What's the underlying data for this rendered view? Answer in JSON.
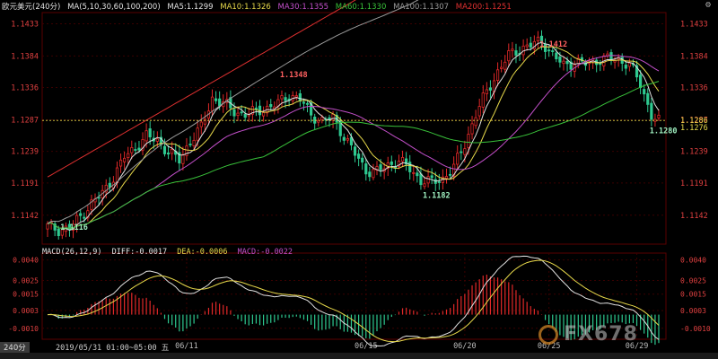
{
  "header": {
    "symbol": "欧元美元(240分)",
    "ma_params": "MA(5,10,30,60,100,200)",
    "ma_values": [
      {
        "label": "MA5:1.1299",
        "color": "#e0e0e0"
      },
      {
        "label": "MA10:1.1326",
        "color": "#e6d84a"
      },
      {
        "label": "MA30:1.1355",
        "color": "#c24fc9"
      },
      {
        "label": "MA60:1.1330",
        "color": "#39c23a"
      },
      {
        "label": "MA100:1.1307",
        "color": "#9a9a9a"
      },
      {
        "label": "MA200:1.1251",
        "color": "#e03030"
      }
    ]
  },
  "macd_header": {
    "params": "MACD(26,12,9)",
    "diff": "DIFF:-0.0017",
    "dea": "DEA:-0.0006",
    "macd": "MACD:-0.0022"
  },
  "footer": {
    "timeframe": "240分",
    "datetime": "2019/05/31 01:00~05:00 五",
    "watermark": "FX678"
  },
  "chart_data": [
    {
      "type": "candlestick",
      "title": "欧元美元(240分)",
      "y_ticks": [
        1.1433,
        1.1384,
        1.1336,
        1.1287,
        1.1239,
        1.1191,
        1.1142
      ],
      "ylim": [
        1.1098,
        1.145
      ],
      "x_ticks": [
        "06/11",
        "06/15",
        "06/20",
        "06/25",
        "06/29"
      ],
      "current_price_labels": [
        "1.1286",
        "1.1276"
      ],
      "annotations": [
        {
          "text": "1.1116",
          "value": 1.1116
        },
        {
          "text": "1.1348",
          "value": 1.1348
        },
        {
          "text": "1.1182",
          "value": 1.1182
        },
        {
          "text": "1.1412",
          "value": 1.1412
        },
        {
          "text": "1.1280",
          "value": 1.128
        }
      ],
      "close_anchors": [
        [
          0,
          1.1125
        ],
        [
          3,
          1.112
        ],
        [
          6,
          1.1122
        ],
        [
          9,
          1.114
        ],
        [
          12,
          1.116
        ],
        [
          15,
          1.1175
        ],
        [
          18,
          1.12
        ],
        [
          21,
          1.123
        ],
        [
          24,
          1.1245
        ],
        [
          27,
          1.1262
        ],
        [
          30,
          1.1255
        ],
        [
          33,
          1.1238
        ],
        [
          36,
          1.1225
        ],
        [
          39,
          1.1255
        ],
        [
          42,
          1.1275
        ],
        [
          45,
          1.132
        ],
        [
          48,
          1.1312
        ],
        [
          51,
          1.13
        ],
        [
          54,
          1.1295
        ],
        [
          57,
          1.13
        ],
        [
          60,
          1.1305
        ],
        [
          63,
          1.1312
        ],
        [
          66,
          1.1325
        ],
        [
          69,
          1.1318
        ],
        [
          72,
          1.1295
        ],
        [
          75,
          1.1285
        ],
        [
          78,
          1.129
        ],
        [
          81,
          1.1262
        ],
        [
          84,
          1.1235
        ],
        [
          87,
          1.121
        ],
        [
          90,
          1.1208
        ],
        [
          93,
          1.1218
        ],
        [
          96,
          1.1225
        ],
        [
          99,
          1.1212
        ],
        [
          102,
          1.1195
        ],
        [
          105,
          1.1192
        ],
        [
          108,
          1.1198
        ],
        [
          111,
          1.1215
        ],
        [
          114,
          1.125
        ],
        [
          117,
          1.1295
        ],
        [
          120,
          1.133
        ],
        [
          123,
          1.136
        ],
        [
          126,
          1.1385
        ],
        [
          129,
          1.1395
        ],
        [
          132,
          1.14
        ],
        [
          135,
          1.1408
        ],
        [
          138,
          1.1385
        ],
        [
          141,
          1.137
        ],
        [
          144,
          1.1375
        ],
        [
          147,
          1.1372
        ],
        [
          150,
          1.1378
        ],
        [
          153,
          1.138
        ],
        [
          156,
          1.1378
        ],
        [
          159,
          1.1372
        ],
        [
          162,
          1.134
        ],
        [
          165,
          1.1295
        ],
        [
          167,
          1.1285
        ]
      ]
    },
    {
      "type": "bar",
      "title": "MACD(26,12,9)",
      "y_ticks": [
        0.004,
        0.0025,
        0.0015,
        0.0003,
        -0.001
      ],
      "y_tick_labels": [
        "0.0040",
        "0.0025",
        "0.0015",
        "0.0003",
        "-0.0010"
      ],
      "ylim": [
        -0.0018,
        0.0045
      ],
      "series": [
        {
          "name": "DIFF",
          "values": [
            -0.0017
          ]
        },
        {
          "name": "DEA",
          "values": [
            -0.0006
          ]
        },
        {
          "name": "MACD",
          "values": [
            -0.0022
          ]
        }
      ]
    }
  ],
  "colors": {
    "up": "#e02828",
    "down": "#2ec990",
    "diff": "#e0e0e0",
    "dea": "#e6d84a",
    "grid": "#3a0000"
  }
}
